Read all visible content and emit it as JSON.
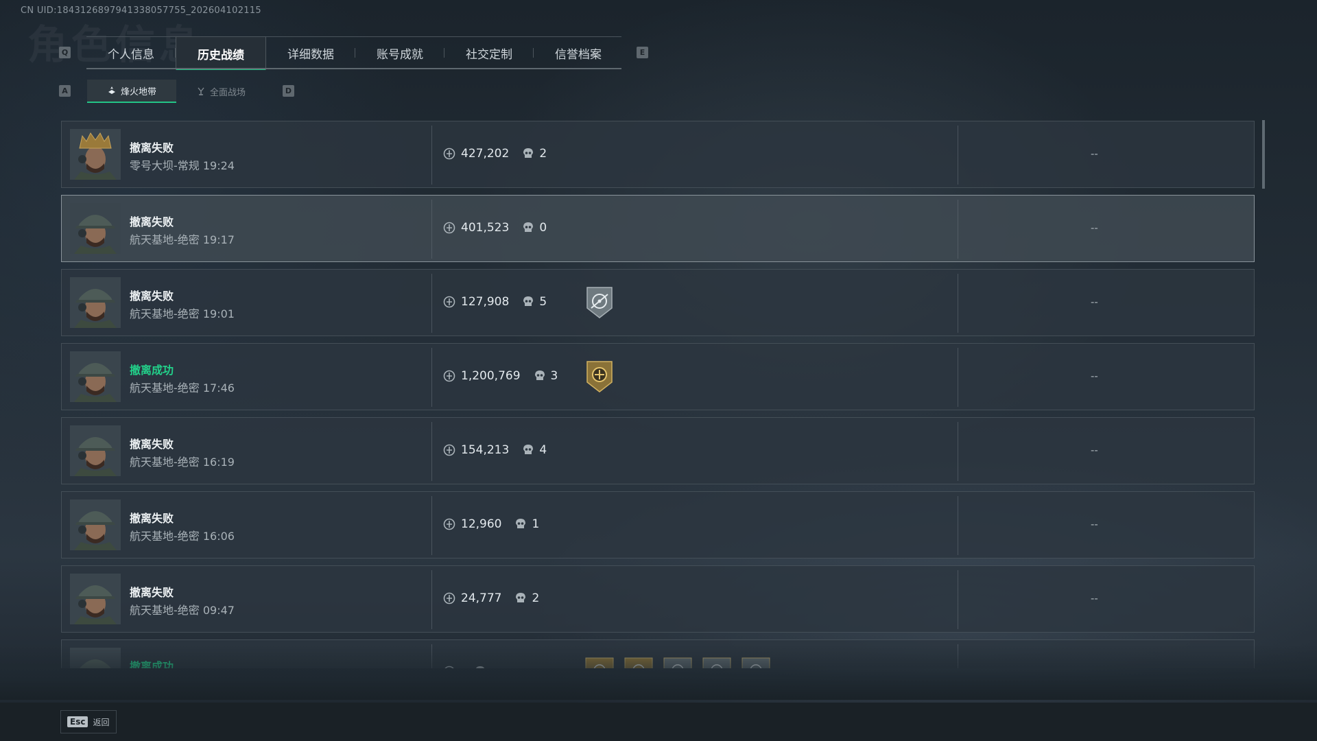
{
  "uid_text": "CN UID:1843126897941338057755_202604102115",
  "ghost_title": "角色信息",
  "tabs": {
    "key_left": "Q",
    "key_right": "E",
    "items": [
      {
        "label": "个人信息"
      },
      {
        "label": "历史战绩"
      },
      {
        "label": "详细数据"
      },
      {
        "label": "账号成就"
      },
      {
        "label": "社交定制"
      },
      {
        "label": "信誉档案"
      }
    ],
    "active_index": 1
  },
  "subtabs": {
    "key_left": "A",
    "key_right": "D",
    "items": [
      {
        "label": "烽火地带",
        "icon": "zone-icon"
      },
      {
        "label": "全面战场",
        "icon": "battlefield-icon"
      }
    ],
    "active_index": 0
  },
  "rows": [
    {
      "status": "撤离失败",
      "map_time": "零号大坝-常规 19:24",
      "value": "427,202",
      "kills": "2",
      "right": "--",
      "success": false,
      "avatar": "operator-1",
      "badge": null
    },
    {
      "status": "撤离失败",
      "map_time": "航天基地-绝密 19:17",
      "value": "401,523",
      "kills": "0",
      "right": "--",
      "success": false,
      "avatar": "operator-2",
      "badge": null
    },
    {
      "status": "撤离失败",
      "map_time": "航天基地-绝密 19:01",
      "value": "127,908",
      "kills": "5",
      "right": "--",
      "success": false,
      "avatar": "operator-2",
      "badge": "crosshair-badge-icon"
    },
    {
      "status": "撤离成功",
      "map_time": "航天基地-绝密 17:46",
      "value": "1,200,769",
      "kills": "3",
      "right": "--",
      "success": true,
      "avatar": "operator-2",
      "badge": "gold-badge-icon"
    },
    {
      "status": "撤离失败",
      "map_time": "航天基地-绝密 16:19",
      "value": "154,213",
      "kills": "4",
      "right": "--",
      "success": false,
      "avatar": "operator-2",
      "badge": null
    },
    {
      "status": "撤离失败",
      "map_time": "航天基地-绝密 16:06",
      "value": "12,960",
      "kills": "1",
      "right": "--",
      "success": false,
      "avatar": "operator-2",
      "badge": null
    },
    {
      "status": "撤离失败",
      "map_time": "航天基地-绝密 09:47",
      "value": "24,777",
      "kills": "2",
      "right": "--",
      "success": false,
      "avatar": "operator-2",
      "badge": null
    },
    {
      "status": "撤离成功",
      "map_time": "",
      "value": "",
      "kills": "",
      "right": "",
      "success": true,
      "avatar": "operator-2",
      "badge": "multi"
    }
  ],
  "selected_row": 1,
  "footer": {
    "esc_key": "Esc",
    "esc_label": "返回"
  },
  "colors": {
    "accent": "#23c587",
    "success": "#22d18a"
  }
}
